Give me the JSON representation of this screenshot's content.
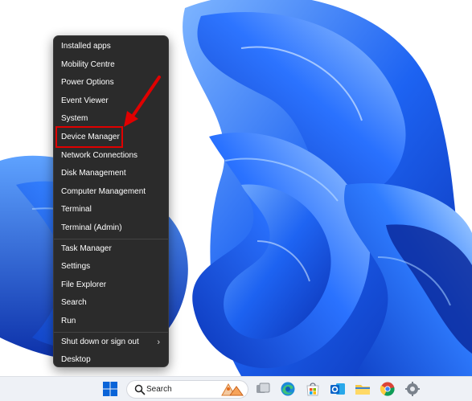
{
  "context_menu": {
    "items": [
      {
        "label": "Installed apps"
      },
      {
        "label": "Mobility Centre"
      },
      {
        "label": "Power Options"
      },
      {
        "label": "Event Viewer"
      },
      {
        "label": "System"
      },
      {
        "label": "Device Manager"
      },
      {
        "label": "Network Connections"
      },
      {
        "label": "Disk Management"
      },
      {
        "label": "Computer Management"
      },
      {
        "label": "Terminal"
      },
      {
        "label": "Terminal (Admin)"
      },
      {
        "label": "Task Manager"
      },
      {
        "label": "Settings"
      },
      {
        "label": "File Explorer"
      },
      {
        "label": "Search"
      },
      {
        "label": "Run"
      },
      {
        "label": "Shut down or sign out"
      },
      {
        "label": "Desktop"
      }
    ],
    "highlighted_item": "Device Manager",
    "submenu_chevron": "›"
  },
  "taskbar": {
    "search_label": "Search",
    "icons": [
      "windows-start-icon",
      "search-icon",
      "task-view-icon",
      "edge-icon",
      "microsoft-store-icon",
      "outlook-icon",
      "file-explorer-icon",
      "chrome-icon",
      "settings-icon"
    ]
  },
  "colors": {
    "menu_background": "#2b2b2b",
    "menu_text": "#ffffff",
    "highlight_border": "#e00000",
    "arrow": "#e00000",
    "taskbar_background": "#eef1f6",
    "wallpaper_blue": "#1a5cf0"
  }
}
